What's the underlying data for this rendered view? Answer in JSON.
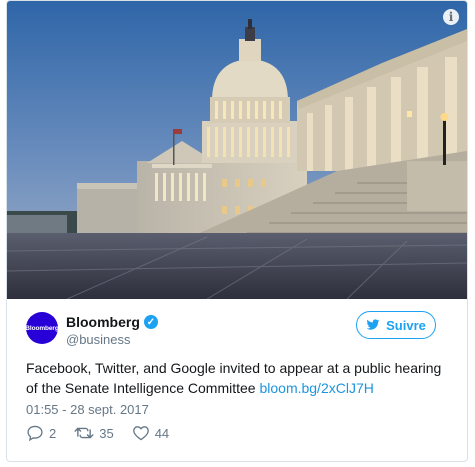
{
  "photo": {
    "alt_scene": "capitol-dome-at-dusk",
    "info_glyph": "i"
  },
  "account": {
    "avatar_text": "Bloomberg",
    "name": "Bloomberg",
    "handle": "@business",
    "verified_glyph": "✓"
  },
  "follow_button": {
    "label": "Suivre"
  },
  "tweet": {
    "text": "Facebook, Twitter, and Google invited to appear at a public hearing of the Senate Intelligence Committee ",
    "link": "bloom.bg/2xClJ7H",
    "timestamp": "01:55 - 28 sept. 2017"
  },
  "actions": {
    "replies": "2",
    "retweets": "35",
    "likes": "44"
  },
  "colors": {
    "accent": "#1da1f2",
    "link": "#1b95e0",
    "avatar_bg": "#2800d7"
  },
  "icons": {
    "info": "info-icon",
    "verified": "verified-badge-icon",
    "follow": "twitter-bird-icon",
    "reply": "reply-icon",
    "retweet": "retweet-icon",
    "like": "heart-icon"
  }
}
